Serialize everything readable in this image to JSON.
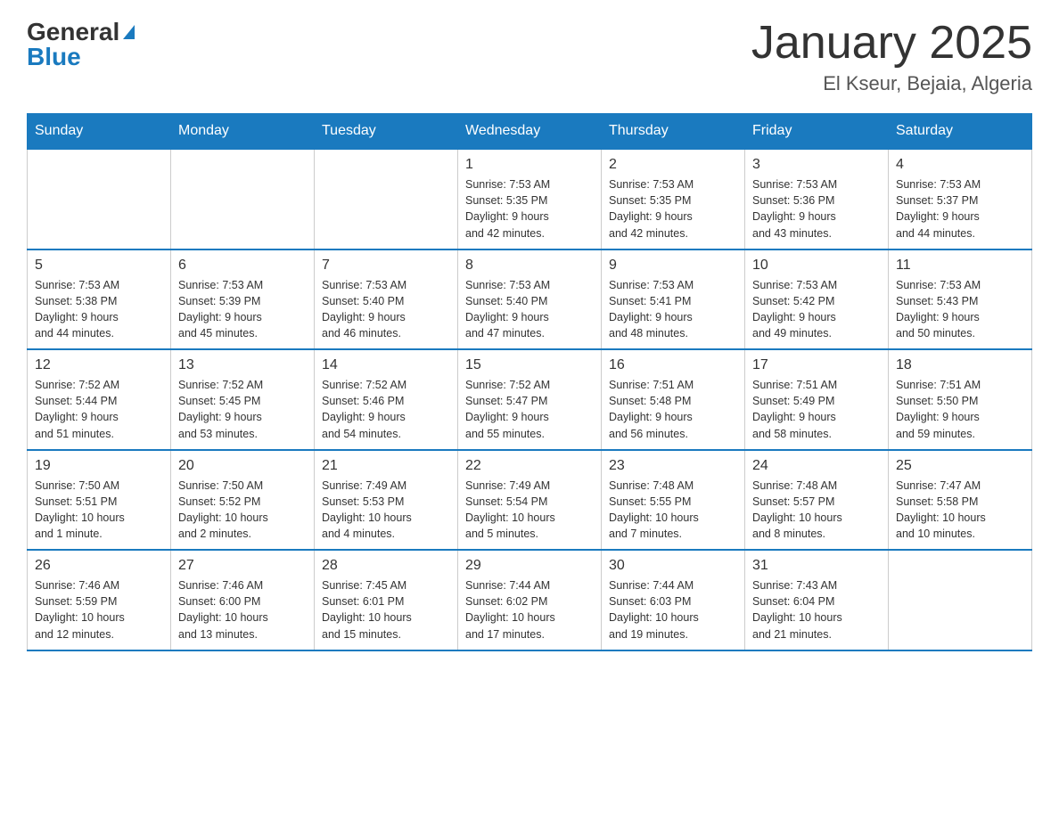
{
  "header": {
    "logo_general": "General",
    "logo_blue": "Blue",
    "month_title": "January 2025",
    "location": "El Kseur, Bejaia, Algeria"
  },
  "weekdays": [
    "Sunday",
    "Monday",
    "Tuesday",
    "Wednesday",
    "Thursday",
    "Friday",
    "Saturday"
  ],
  "weeks": [
    [
      {
        "day": "",
        "info": ""
      },
      {
        "day": "",
        "info": ""
      },
      {
        "day": "",
        "info": ""
      },
      {
        "day": "1",
        "info": "Sunrise: 7:53 AM\nSunset: 5:35 PM\nDaylight: 9 hours\nand 42 minutes."
      },
      {
        "day": "2",
        "info": "Sunrise: 7:53 AM\nSunset: 5:35 PM\nDaylight: 9 hours\nand 42 minutes."
      },
      {
        "day": "3",
        "info": "Sunrise: 7:53 AM\nSunset: 5:36 PM\nDaylight: 9 hours\nand 43 minutes."
      },
      {
        "day": "4",
        "info": "Sunrise: 7:53 AM\nSunset: 5:37 PM\nDaylight: 9 hours\nand 44 minutes."
      }
    ],
    [
      {
        "day": "5",
        "info": "Sunrise: 7:53 AM\nSunset: 5:38 PM\nDaylight: 9 hours\nand 44 minutes."
      },
      {
        "day": "6",
        "info": "Sunrise: 7:53 AM\nSunset: 5:39 PM\nDaylight: 9 hours\nand 45 minutes."
      },
      {
        "day": "7",
        "info": "Sunrise: 7:53 AM\nSunset: 5:40 PM\nDaylight: 9 hours\nand 46 minutes."
      },
      {
        "day": "8",
        "info": "Sunrise: 7:53 AM\nSunset: 5:40 PM\nDaylight: 9 hours\nand 47 minutes."
      },
      {
        "day": "9",
        "info": "Sunrise: 7:53 AM\nSunset: 5:41 PM\nDaylight: 9 hours\nand 48 minutes."
      },
      {
        "day": "10",
        "info": "Sunrise: 7:53 AM\nSunset: 5:42 PM\nDaylight: 9 hours\nand 49 minutes."
      },
      {
        "day": "11",
        "info": "Sunrise: 7:53 AM\nSunset: 5:43 PM\nDaylight: 9 hours\nand 50 minutes."
      }
    ],
    [
      {
        "day": "12",
        "info": "Sunrise: 7:52 AM\nSunset: 5:44 PM\nDaylight: 9 hours\nand 51 minutes."
      },
      {
        "day": "13",
        "info": "Sunrise: 7:52 AM\nSunset: 5:45 PM\nDaylight: 9 hours\nand 53 minutes."
      },
      {
        "day": "14",
        "info": "Sunrise: 7:52 AM\nSunset: 5:46 PM\nDaylight: 9 hours\nand 54 minutes."
      },
      {
        "day": "15",
        "info": "Sunrise: 7:52 AM\nSunset: 5:47 PM\nDaylight: 9 hours\nand 55 minutes."
      },
      {
        "day": "16",
        "info": "Sunrise: 7:51 AM\nSunset: 5:48 PM\nDaylight: 9 hours\nand 56 minutes."
      },
      {
        "day": "17",
        "info": "Sunrise: 7:51 AM\nSunset: 5:49 PM\nDaylight: 9 hours\nand 58 minutes."
      },
      {
        "day": "18",
        "info": "Sunrise: 7:51 AM\nSunset: 5:50 PM\nDaylight: 9 hours\nand 59 minutes."
      }
    ],
    [
      {
        "day": "19",
        "info": "Sunrise: 7:50 AM\nSunset: 5:51 PM\nDaylight: 10 hours\nand 1 minute."
      },
      {
        "day": "20",
        "info": "Sunrise: 7:50 AM\nSunset: 5:52 PM\nDaylight: 10 hours\nand 2 minutes."
      },
      {
        "day": "21",
        "info": "Sunrise: 7:49 AM\nSunset: 5:53 PM\nDaylight: 10 hours\nand 4 minutes."
      },
      {
        "day": "22",
        "info": "Sunrise: 7:49 AM\nSunset: 5:54 PM\nDaylight: 10 hours\nand 5 minutes."
      },
      {
        "day": "23",
        "info": "Sunrise: 7:48 AM\nSunset: 5:55 PM\nDaylight: 10 hours\nand 7 minutes."
      },
      {
        "day": "24",
        "info": "Sunrise: 7:48 AM\nSunset: 5:57 PM\nDaylight: 10 hours\nand 8 minutes."
      },
      {
        "day": "25",
        "info": "Sunrise: 7:47 AM\nSunset: 5:58 PM\nDaylight: 10 hours\nand 10 minutes."
      }
    ],
    [
      {
        "day": "26",
        "info": "Sunrise: 7:46 AM\nSunset: 5:59 PM\nDaylight: 10 hours\nand 12 minutes."
      },
      {
        "day": "27",
        "info": "Sunrise: 7:46 AM\nSunset: 6:00 PM\nDaylight: 10 hours\nand 13 minutes."
      },
      {
        "day": "28",
        "info": "Sunrise: 7:45 AM\nSunset: 6:01 PM\nDaylight: 10 hours\nand 15 minutes."
      },
      {
        "day": "29",
        "info": "Sunrise: 7:44 AM\nSunset: 6:02 PM\nDaylight: 10 hours\nand 17 minutes."
      },
      {
        "day": "30",
        "info": "Sunrise: 7:44 AM\nSunset: 6:03 PM\nDaylight: 10 hours\nand 19 minutes."
      },
      {
        "day": "31",
        "info": "Sunrise: 7:43 AM\nSunset: 6:04 PM\nDaylight: 10 hours\nand 21 minutes."
      },
      {
        "day": "",
        "info": ""
      }
    ]
  ]
}
